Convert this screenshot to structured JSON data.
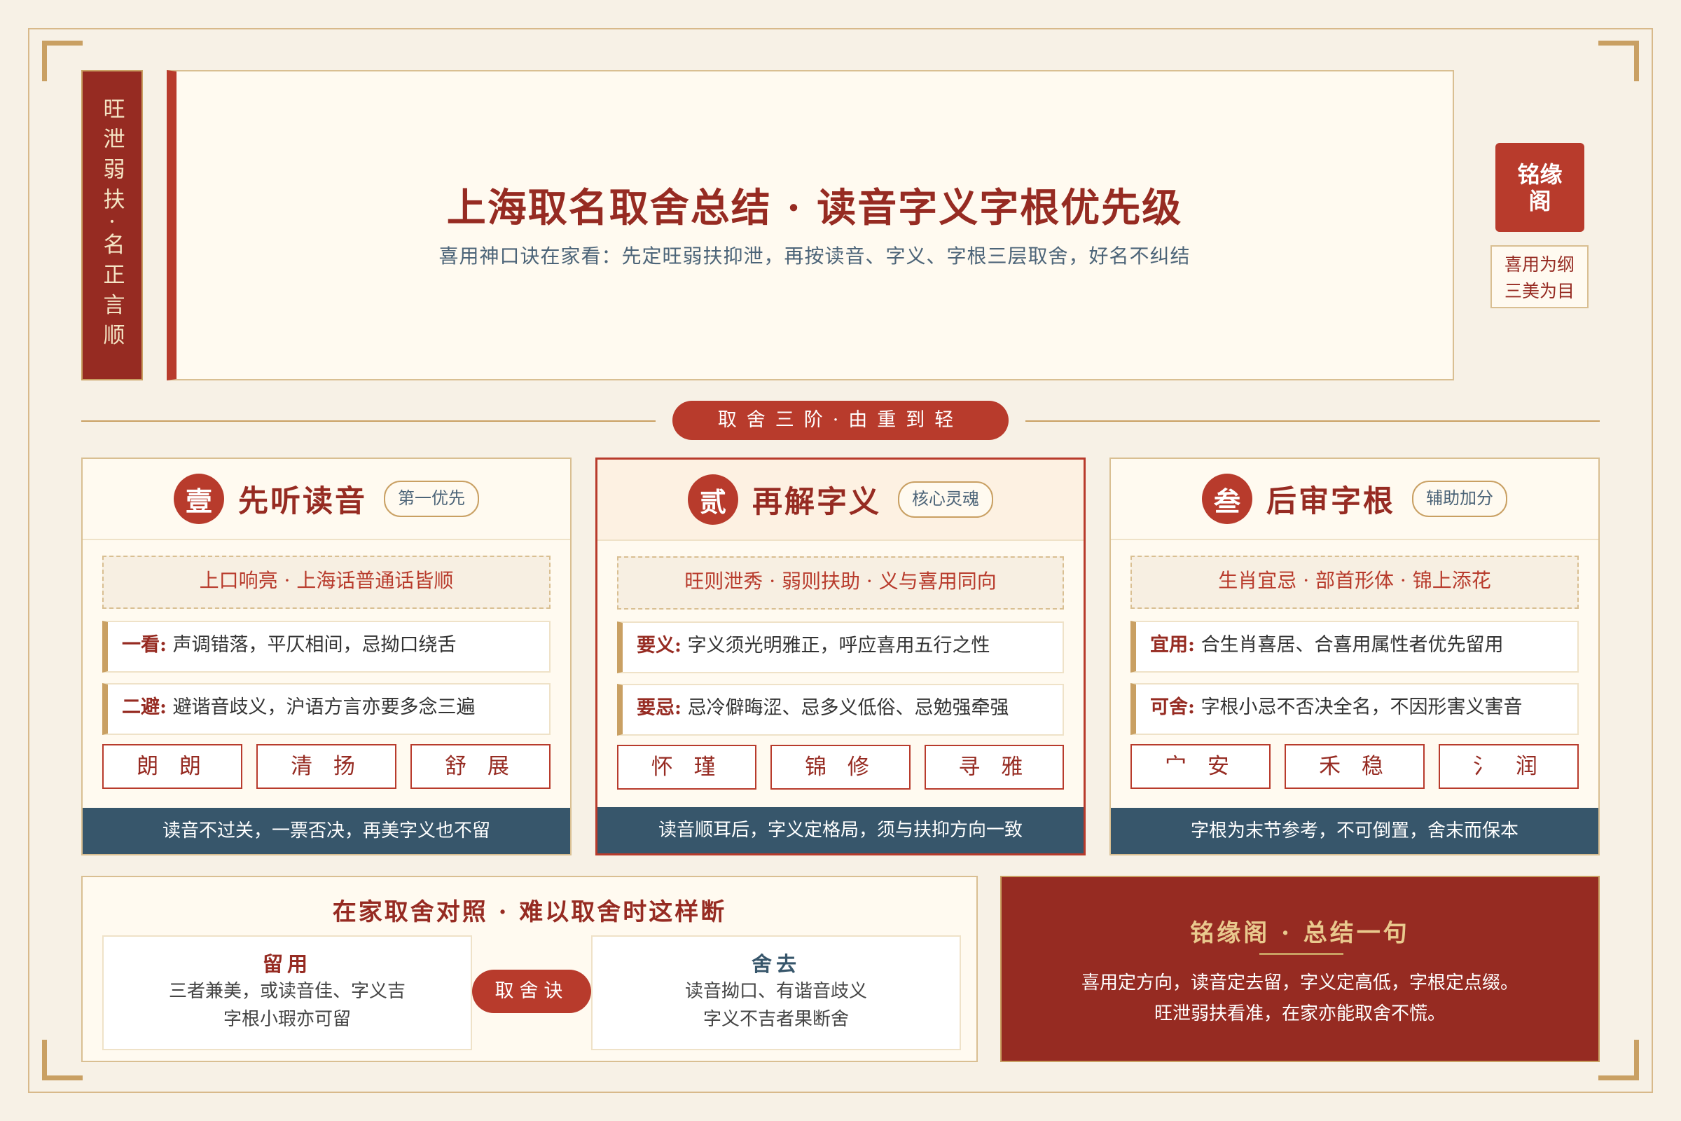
{
  "banner": {
    "vertical_text": "旺泄弱扶·名正言顺"
  },
  "header": {
    "title": "上海取名取舍总结 · 读音字义字根优先级",
    "subtitle": "喜用神口诀在家看：先定旺弱扶抑泄，再按读音、字义、字根三层取舍，好名不纠结"
  },
  "seal": {
    "text": "铭缘阁",
    "sub_line1": "喜用为纲",
    "sub_line2": "三美为目"
  },
  "divider": {
    "label": "取舍三阶·由重到轻"
  },
  "cards": [
    {
      "badge": "壹",
      "title": "先听读音",
      "tag": "第一优先",
      "motto": "上口响亮 · 上海话普通话皆顺",
      "rule1_key": "一看:",
      "rule1_text": "声调错落，平仄相间，忌拗口绕舌",
      "rule2_key": "二避:",
      "rule2_text": "避谐音歧义，沪语方言亦要多念三遍",
      "chars": [
        "朗 朗",
        "清 扬",
        "舒 展"
      ],
      "footer": "读音不过关，一票否决，再美字义也不留"
    },
    {
      "badge": "贰",
      "title": "再解字义",
      "tag": "核心灵魂",
      "motto": "旺则泄秀 · 弱则扶助 · 义与喜用同向",
      "rule1_key": "要义:",
      "rule1_text": "字义须光明雅正，呼应喜用五行之性",
      "rule2_key": "要忌:",
      "rule2_text": "忌冷僻晦涩、忌多义低俗、忌勉强牵强",
      "chars": [
        "怀 瑾",
        "锦 修",
        "寻 雅"
      ],
      "footer": "读音顺耳后，字义定格局，须与扶抑方向一致"
    },
    {
      "badge": "叁",
      "title": "后审字根",
      "tag": "辅助加分",
      "motto": "生肖宜忌 · 部首形体 · 锦上添花",
      "rule1_key": "宜用:",
      "rule1_text": "合生肖喜居、合喜用属性者优先留用",
      "rule2_key": "可舍:",
      "rule2_text": "字根小忌不否决全名，不因形害义害音",
      "chars": [
        "宀 安",
        "禾 稳",
        "氵 润"
      ],
      "footer": "字根为末节参考，不可倒置，舍末而保本"
    }
  ],
  "compare": {
    "title": "在家取舍对照 · 难以取舍时这样断",
    "keep_title": "留用",
    "keep_line1": "三者兼美，或读音佳、字义吉",
    "keep_line2": "字根小瑕亦可留",
    "key_label": "取舍诀",
    "drop_title": "舍去",
    "drop_line1": "读音拗口、有谐音歧义",
    "drop_line2": "字义不吉者果断舍"
  },
  "summary": {
    "title": "铭缘阁 · 总结一句",
    "line1": "喜用定方向，读音定去留，字义定高低，字根定点缀。",
    "line2": "旺泄弱扶看准，在家亦能取舍不慌。"
  },
  "colors": {
    "accent": "#b83b2c",
    "deep_red": "#962b22",
    "gold": "#c9a063",
    "navy": "#37566b",
    "paper": "#fffaf0"
  }
}
